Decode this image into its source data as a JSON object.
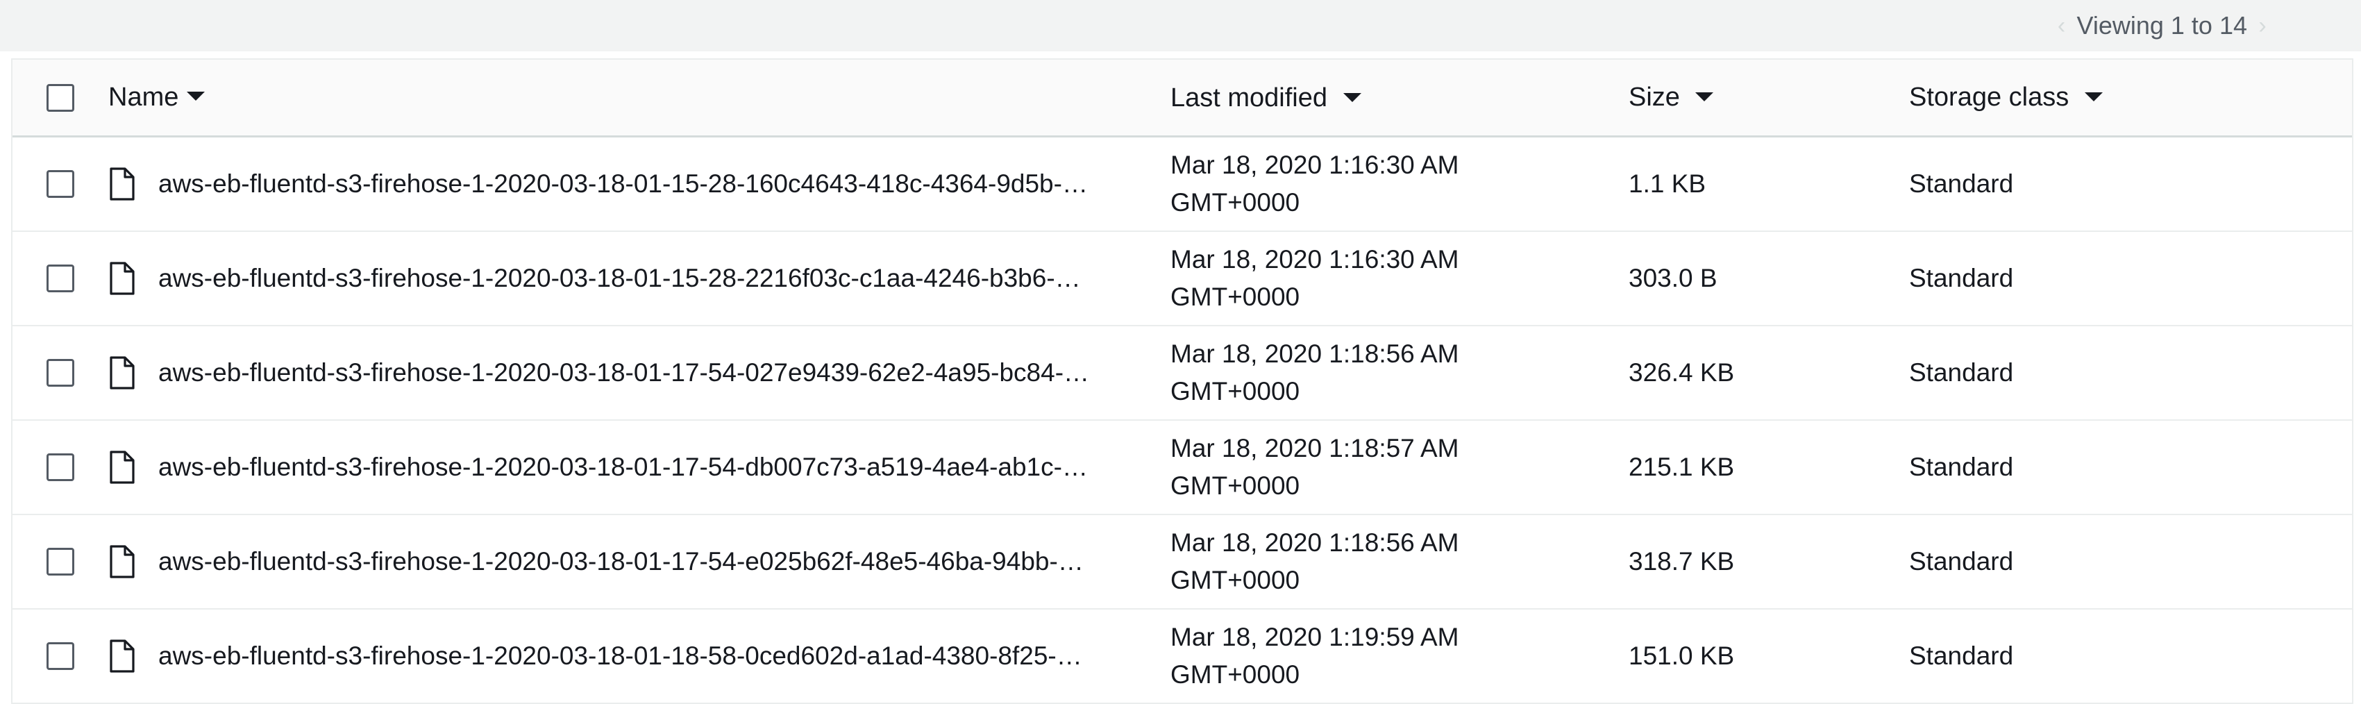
{
  "pagination": {
    "text": "Viewing 1 to 14",
    "prev_icon": "chevron-left-icon",
    "next_icon": "chevron-right-icon"
  },
  "table": {
    "columns": {
      "name": "Name",
      "last_modified": "Last modified",
      "size": "Size",
      "storage_class": "Storage class"
    },
    "rows": [
      {
        "name": "aws-eb-fluentd-s3-firehose-1-2020-03-18-01-15-28-160c4643-418c-4364-9d5b-…",
        "date": "Mar 18, 2020 1:16:30 AM",
        "tz": "GMT+0000",
        "size": "1.1 KB",
        "storage_class": "Standard"
      },
      {
        "name": "aws-eb-fluentd-s3-firehose-1-2020-03-18-01-15-28-2216f03c-c1aa-4246-b3b6-…",
        "date": "Mar 18, 2020 1:16:30 AM",
        "tz": "GMT+0000",
        "size": "303.0 B",
        "storage_class": "Standard"
      },
      {
        "name": "aws-eb-fluentd-s3-firehose-1-2020-03-18-01-17-54-027e9439-62e2-4a95-bc84-…",
        "date": "Mar 18, 2020 1:18:56 AM",
        "tz": "GMT+0000",
        "size": "326.4 KB",
        "storage_class": "Standard"
      },
      {
        "name": "aws-eb-fluentd-s3-firehose-1-2020-03-18-01-17-54-db007c73-a519-4ae4-ab1c-…",
        "date": "Mar 18, 2020 1:18:57 AM",
        "tz": "GMT+0000",
        "size": "215.1 KB",
        "storage_class": "Standard"
      },
      {
        "name": "aws-eb-fluentd-s3-firehose-1-2020-03-18-01-17-54-e025b62f-48e5-46ba-94bb-…",
        "date": "Mar 18, 2020 1:18:56 AM",
        "tz": "GMT+0000",
        "size": "318.7 KB",
        "storage_class": "Standard"
      },
      {
        "name": "aws-eb-fluentd-s3-firehose-1-2020-03-18-01-18-58-0ced602d-a1ad-4380-8f25-…",
        "date": "Mar 18, 2020 1:19:59 AM",
        "tz": "GMT+0000",
        "size": "151.0 KB",
        "storage_class": "Standard"
      }
    ]
  }
}
